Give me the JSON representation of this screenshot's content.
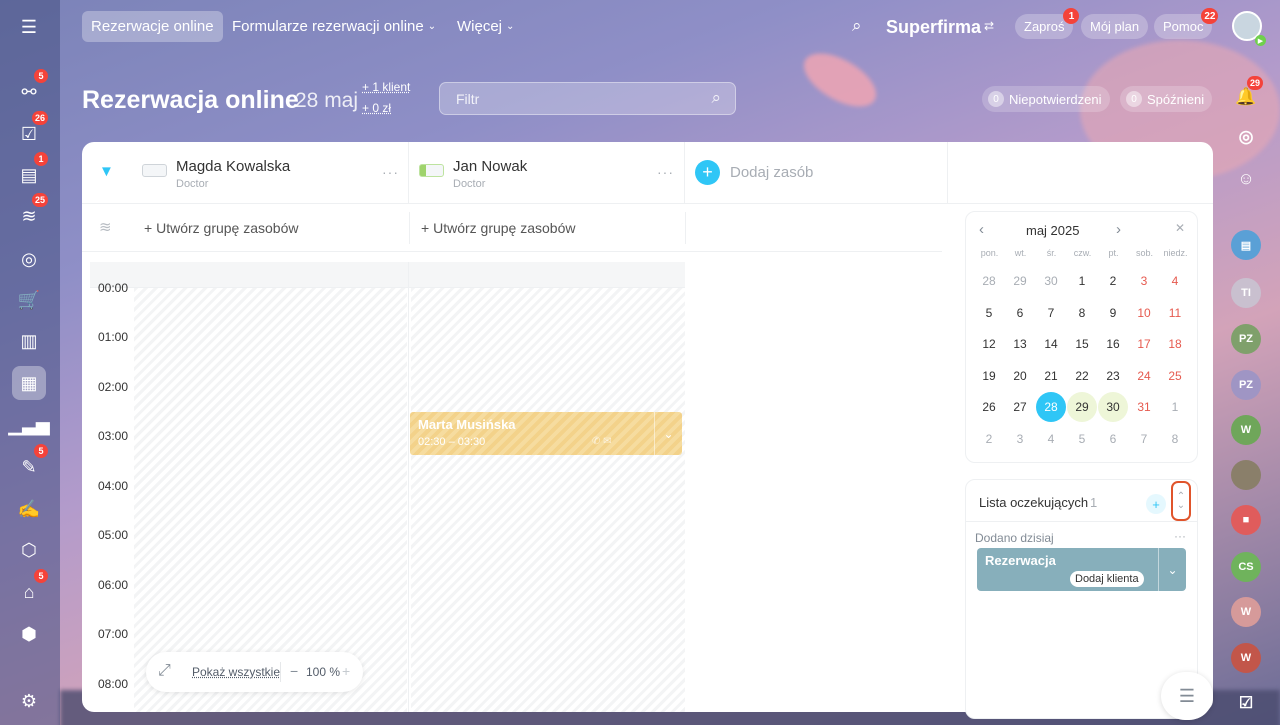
{
  "topbar": {
    "tabs": [
      {
        "label": "Rezerwacje online"
      },
      {
        "label": "Formularze rezerwacji online"
      },
      {
        "label": "Więcej"
      }
    ],
    "company": "Superfirma",
    "invite_label": "Zaproś",
    "invite_badge": "1",
    "myplan_label": "Mój plan",
    "help_label": "Pomoc",
    "help_badge": "22"
  },
  "header": {
    "title": "Rezerwacja online",
    "date": "28 maj",
    "clients_stat": "+ 1 klient",
    "money_stat": "+ 0 zł",
    "filter_placeholder": "Filtr",
    "unconfirmed_count": "0",
    "unconfirmed_label": "Niepotwierdzeni",
    "late_count": "0",
    "late_label": "Spóźnieni"
  },
  "resources": [
    {
      "name": "Magda Kowalska",
      "role": "Doctor"
    },
    {
      "name": "Jan Nowak",
      "role": "Doctor"
    }
  ],
  "add_resource_label": "Dodaj zasób",
  "create_group_label": "Utwórz grupę zasobów",
  "times": [
    "00:00",
    "01:00",
    "02:00",
    "03:00",
    "04:00",
    "05:00",
    "06:00",
    "07:00",
    "08:00"
  ],
  "booking": {
    "client": "Marta Musińska",
    "time": "02:30 – 03:30"
  },
  "zoom": {
    "show_all_label": "Pokaż wszystkie",
    "level": "100 %"
  },
  "calendar": {
    "month": "maj 2025",
    "weekdays": [
      "pon.",
      "wt.",
      "śr.",
      "czw.",
      "pt.",
      "sob.",
      "niedz."
    ],
    "weeks": [
      [
        "28",
        "29",
        "30",
        "1",
        "2",
        "3",
        "4"
      ],
      [
        "5",
        "6",
        "7",
        "8",
        "9",
        "10",
        "11"
      ],
      [
        "12",
        "13",
        "14",
        "15",
        "16",
        "17",
        "18"
      ],
      [
        "19",
        "20",
        "21",
        "22",
        "23",
        "24",
        "25"
      ],
      [
        "26",
        "27",
        "28",
        "29",
        "30",
        "31",
        "1"
      ],
      [
        "2",
        "3",
        "4",
        "5",
        "6",
        "7",
        "8"
      ]
    ],
    "selected": "28",
    "weekend_color": "#e65a4f",
    "selected_color": "#2fc6f6"
  },
  "waitlist": {
    "title": "Lista oczekujących",
    "count": "1",
    "added_today_label": "Dodano dzisiaj",
    "item_title": "Rezerwacja",
    "add_client_label": "Dodaj klienta"
  },
  "sidebar_badges": {
    "b1": "5",
    "b2": "26",
    "b3": "1",
    "b4": "25",
    "b5": "5",
    "b6": "5"
  },
  "rightbar": {
    "badge": "29",
    "avatars": [
      "TI",
      "PZ",
      "PZ",
      "W",
      "CS",
      "W",
      "W"
    ]
  }
}
